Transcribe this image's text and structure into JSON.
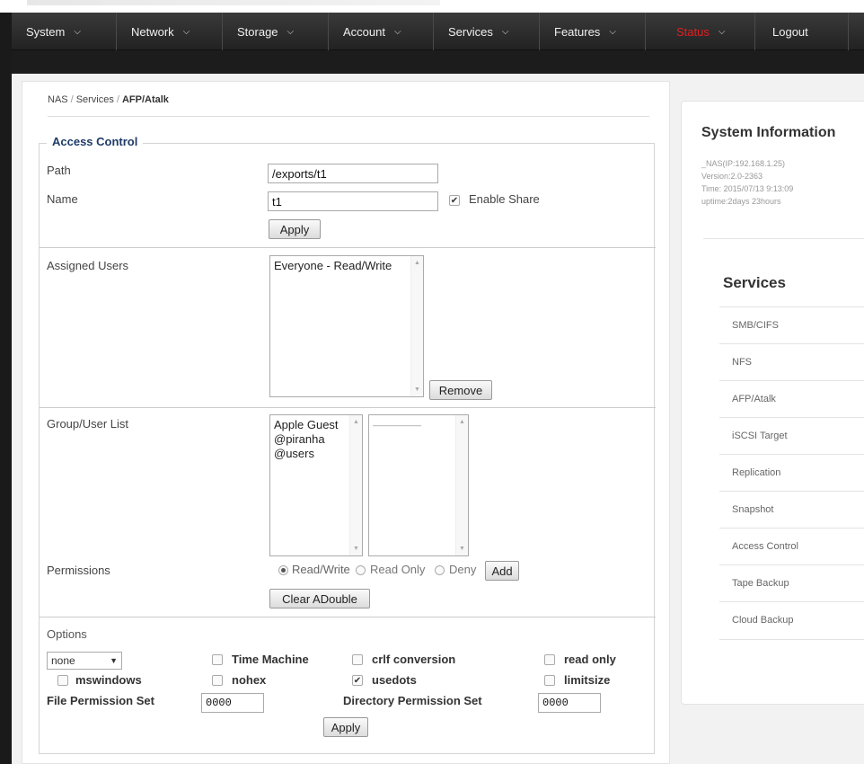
{
  "nav": {
    "items": [
      {
        "label": "System"
      },
      {
        "label": "Network"
      },
      {
        "label": "Storage"
      },
      {
        "label": "Account"
      },
      {
        "label": "Services"
      },
      {
        "label": "Features"
      },
      {
        "label": "Status"
      },
      {
        "label": "Logout"
      }
    ]
  },
  "breadcrumb": {
    "root": "NAS",
    "parent": "Services",
    "current": "AFP/Atalk"
  },
  "access_control": {
    "legend": "Access Control",
    "path_label": "Path",
    "path_value": "/exports/t1",
    "name_label": "Name",
    "name_value": "t1",
    "enable_share_label": "Enable Share",
    "enable_share_checked": true,
    "apply_label": "Apply"
  },
  "assigned_users": {
    "label": "Assigned Users",
    "items": [
      "Everyone - Read/Write"
    ],
    "remove_label": "Remove"
  },
  "group_user_list": {
    "label": "Group/User List",
    "items": [
      "Apple Guest",
      "@piranha",
      "@users"
    ],
    "second_items": [
      "——————"
    ]
  },
  "permissions": {
    "label": "Permissions",
    "options": [
      "Read/Write",
      "Read Only",
      "Deny"
    ],
    "selected": "Read/Write",
    "add_label": "Add",
    "clear_label": "Clear ADouble"
  },
  "options": {
    "label": "Options",
    "select_value": "none",
    "checkboxes": {
      "time_machine": "Time Machine",
      "crlf_conversion": "crlf conversion",
      "read_only": "read only",
      "mswindows": "mswindows",
      "nohex": "nohex",
      "usedots": "usedots",
      "limitsize": "limitsize"
    },
    "usedots_checked": true,
    "file_perm_label": "File Permission Set",
    "file_perm_value": "0000",
    "dir_perm_label": "Directory Permission Set",
    "dir_perm_value": "0000",
    "apply_label": "Apply"
  },
  "system_info": {
    "title": "System Information",
    "lines": [
      "_NAS(IP:192.168.1.25)",
      "Version:2.0-2363",
      "Time: 2015/07/13 9:13:09",
      "uptime:2days 23hours"
    ]
  },
  "services_side": {
    "title": "Services",
    "items": [
      "SMB/CIFS",
      "NFS",
      "AFP/Atalk",
      "iSCSI Target",
      "Replication",
      "Snapshot",
      "Access Control",
      "Tape Backup",
      "Cloud Backup"
    ]
  },
  "colors": {
    "nav_bg": "#2a2a2a",
    "status_accent": "#e02020",
    "legend": "#1f3b68"
  }
}
